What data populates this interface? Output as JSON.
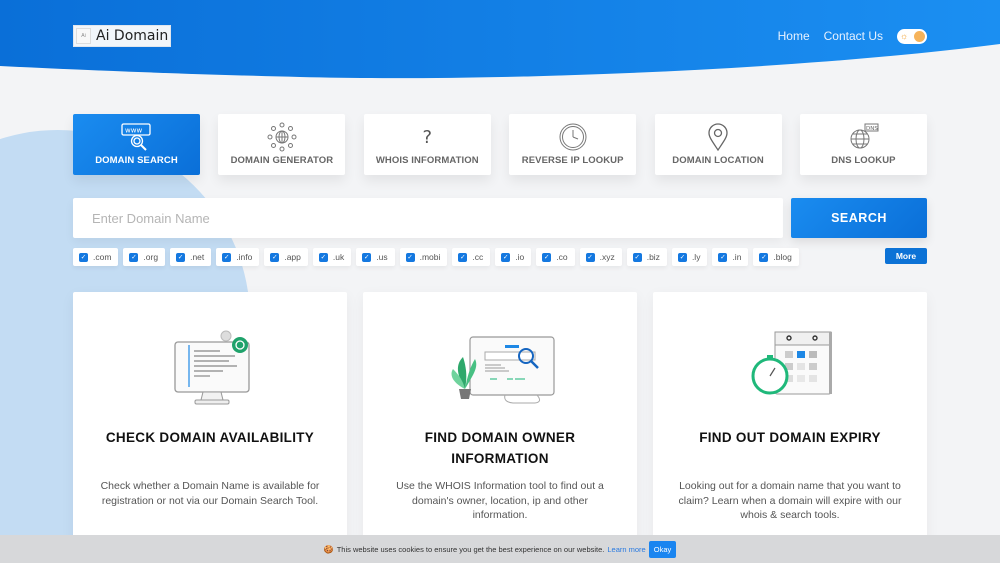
{
  "header": {
    "logo_text": "Ai Domain",
    "logo_badge": "Ai",
    "nav": [
      {
        "label": "Home"
      },
      {
        "label": "Contact Us"
      }
    ],
    "theme_toggle": {
      "icon": "sun-icon",
      "state": "light"
    },
    "colors": {
      "brand_start": "#0a6fd8",
      "brand_end": "#1a8cf0"
    }
  },
  "tools": [
    {
      "label": "DOMAIN SEARCH",
      "icon": "www-search-icon",
      "active": true
    },
    {
      "label": "DOMAIN GENERATOR",
      "icon": "network-globe-icon",
      "active": false
    },
    {
      "label": "WHOIS INFORMATION",
      "icon": "question-mark-icon",
      "active": false
    },
    {
      "label": "REVERSE IP LOOKUP",
      "icon": "clock-icon",
      "active": false
    },
    {
      "label": "DOMAIN LOCATION",
      "icon": "map-pin-icon",
      "active": false
    },
    {
      "label": "DNS LOOKUP",
      "icon": "dns-globe-icon",
      "active": false
    }
  ],
  "search": {
    "placeholder": "Enter Domain Name",
    "value": "",
    "button_label": "SEARCH"
  },
  "tlds": {
    "items": [
      {
        "label": ".com",
        "checked": true
      },
      {
        "label": ".org",
        "checked": true
      },
      {
        "label": ".net",
        "checked": true
      },
      {
        "label": ".info",
        "checked": true
      },
      {
        "label": ".app",
        "checked": true
      },
      {
        "label": ".uk",
        "checked": true
      },
      {
        "label": ".us",
        "checked": true
      },
      {
        "label": ".mobi",
        "checked": true
      },
      {
        "label": ".cc",
        "checked": true
      },
      {
        "label": ".io",
        "checked": true
      },
      {
        "label": ".co",
        "checked": true
      },
      {
        "label": ".xyz",
        "checked": true
      },
      {
        "label": ".biz",
        "checked": true
      },
      {
        "label": ".ly",
        "checked": true
      },
      {
        "label": ".in",
        "checked": true
      },
      {
        "label": ".blog",
        "checked": true
      }
    ],
    "more_label": "More"
  },
  "cards": [
    {
      "title": "CHECK DOMAIN AVAILABILITY",
      "text": "Check whether a Domain Name is available for registration or not via our Domain Search Tool.",
      "icon": "monitor-code-gear-illustration"
    },
    {
      "title": "FIND DOMAIN OWNER INFORMATION",
      "text": "Use the WHOIS Information tool to find out a domain's owner, location, ip and other information.",
      "icon": "monitor-search-plant-illustration"
    },
    {
      "title": "FIND OUT DOMAIN EXPIRY",
      "text": "Looking out for a domain name that you want to claim? Learn when a domain will expire with our whois & search tools.",
      "icon": "calendar-stopwatch-illustration"
    }
  ],
  "cookie_banner": {
    "text": "This website uses cookies to ensure you get the best experience on our website.",
    "link_label": "Learn more",
    "button_label": "Okay"
  }
}
